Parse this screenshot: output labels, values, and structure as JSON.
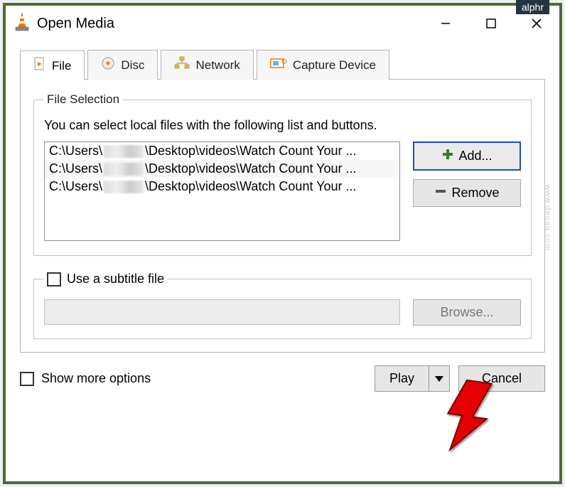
{
  "badge": "alphr",
  "window": {
    "title": "Open Media"
  },
  "tabs": [
    {
      "label": "File",
      "active": true
    },
    {
      "label": "Disc"
    },
    {
      "label": "Network"
    },
    {
      "label": "Capture Device"
    }
  ],
  "file_selection": {
    "legend": "File Selection",
    "hint": "You can select local files with the following list and buttons.",
    "files": [
      {
        "prefix": "C:\\Users\\",
        "suffix": "\\Desktop\\videos\\Watch Count Your ..."
      },
      {
        "prefix": "C:\\Users\\",
        "suffix": "\\Desktop\\videos\\Watch Count Your ..."
      },
      {
        "prefix": "C:\\Users\\",
        "suffix": "\\Desktop\\videos\\Watch Count Your ..."
      }
    ],
    "add_label": "Add...",
    "remove_label": "Remove"
  },
  "subtitle": {
    "legend": "Use a subtitle file",
    "browse_label": "Browse..."
  },
  "show_more": "Show more options",
  "play_label": "Play",
  "cancel_label": "Cancel",
  "watermark": "www.deuaq.com"
}
